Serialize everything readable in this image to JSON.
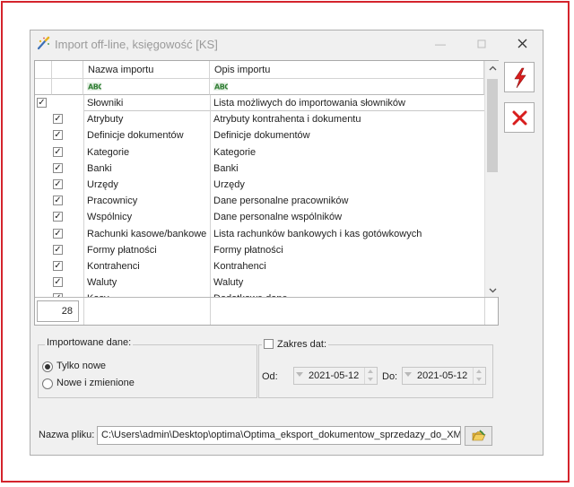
{
  "window": {
    "title": "Import off-line, księgowość [KS]",
    "icons": {
      "app": "optima-wand-icon",
      "minimize": "minimize-icon",
      "maximize": "maximize-icon",
      "close": "close-icon"
    }
  },
  "grid": {
    "columns": [
      "Nazwa importu",
      "Opis importu"
    ],
    "filter_icon": "abc-filter-icon",
    "rows": [
      {
        "name": "Słowniki",
        "desc": "Lista możliwych do importowania słowników",
        "checked": true,
        "level": 0
      },
      {
        "name": "Atrybuty",
        "desc": "Atrybuty kontrahenta i dokumentu",
        "checked": true,
        "level": 1
      },
      {
        "name": "Definicje dokumentów",
        "desc": "Definicje dokumentów",
        "checked": true,
        "level": 1
      },
      {
        "name": "Kategorie",
        "desc": "Kategorie",
        "checked": true,
        "level": 1
      },
      {
        "name": "Banki",
        "desc": "Banki",
        "checked": true,
        "level": 1
      },
      {
        "name": "Urzędy",
        "desc": "Urzędy",
        "checked": true,
        "level": 1
      },
      {
        "name": "Pracownicy",
        "desc": "Dane personalne pracowników",
        "checked": true,
        "level": 1
      },
      {
        "name": "Wspólnicy",
        "desc": "Dane personalne wspólników",
        "checked": true,
        "level": 1
      },
      {
        "name": "Rachunki kasowe/bankowe",
        "desc": "Lista rachunków bankowych i kas gotówkowych",
        "checked": true,
        "level": 1
      },
      {
        "name": "Formy płatności",
        "desc": "Formy płatności",
        "checked": true,
        "level": 1
      },
      {
        "name": "Kontrahenci",
        "desc": "Kontrahenci",
        "checked": true,
        "level": 1
      },
      {
        "name": "Waluty",
        "desc": "Waluty",
        "checked": true,
        "level": 1
      },
      {
        "name": "Kasy",
        "desc": "Dodatkowe dane",
        "checked": true,
        "level": 1
      }
    ],
    "count": "28"
  },
  "buttons": {
    "import_icon": "lightning-icon",
    "cancel_icon": "red-x-icon",
    "browse_icon": "folder-browse-icon"
  },
  "import_data": {
    "label": "Importowane dane:",
    "options": [
      "Tylko nowe",
      "Nowe i zmienione"
    ],
    "selected": 0
  },
  "date_range": {
    "checkbox_label": "Zakres dat:",
    "checked": false,
    "from_label": "Od:",
    "from_value": "2021-05-12",
    "to_label": "Do:",
    "to_value": "2021-05-12"
  },
  "file": {
    "label": "Nazwa pliku:",
    "path": "C:\\Users\\admin\\Desktop\\optima\\Optima_eksport_dokumentow_sprzedazy_do_XML_"
  },
  "colors": {
    "frame": "#d4242c",
    "lightning": "#d81e1e",
    "cancel": "#d81e1e"
  }
}
